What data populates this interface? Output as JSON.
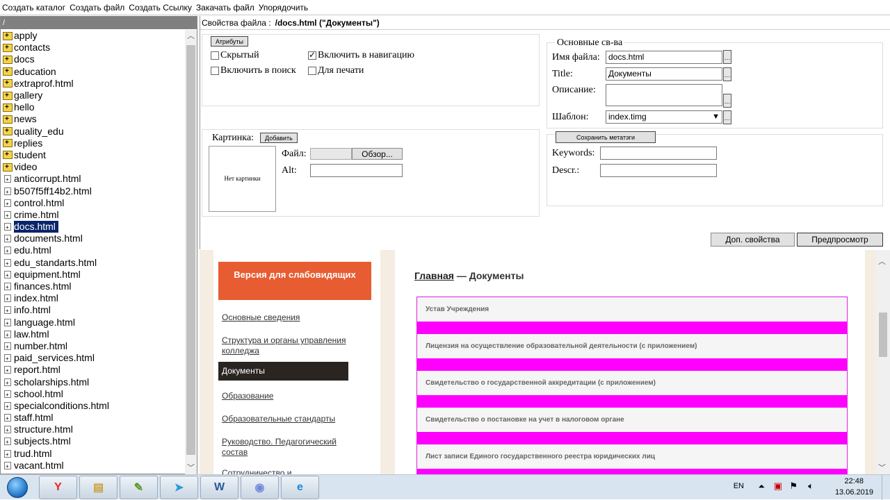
{
  "menu": [
    "Создать каталог",
    "Создать файл",
    "Создать Ссылку",
    "Закачать файл",
    "Упорядочить"
  ],
  "tree": {
    "root": "/",
    "folders": [
      "apply",
      "contacts",
      "docs",
      "education",
      "extraprof.html",
      "gallery",
      "hello",
      "news",
      "quality_edu",
      "replies",
      "student",
      "video"
    ],
    "files": [
      "anticorrupt.html",
      "b507f5ff14b2.html",
      "control.html",
      "crime.html",
      "docs.html",
      "documents.html",
      "edu.html",
      "edu_standarts.html",
      "equipment.html",
      "finances.html",
      "index.html",
      "info.html",
      "language.html",
      "law.html",
      "number.html",
      "paid_services.html",
      "report.html",
      "scholarships.html",
      "school.html",
      "specialconditions.html",
      "staff.html",
      "structure.html",
      "subjects.html",
      "trud.html",
      "vacant.html"
    ],
    "selected": "docs.html"
  },
  "props": {
    "title_label": "Свойства файла :",
    "title_value": "/docs.html (\"Документы\")",
    "attr_button": "Атрибуты",
    "cb_hidden": "Скрытый",
    "cb_nav": "Включить в навигацию",
    "cb_search": "Включить в поиск",
    "cb_print": "Для печати",
    "image_label": "Картинка:",
    "image_add": "Добавить",
    "no_image": "Нет картинки",
    "file_label": "Файл:",
    "browse": "Обзор...",
    "alt_label": "Alt:",
    "main_legend": "Основные св-ва",
    "filename_label": "Имя файла:",
    "filename_value": "docs.html",
    "title_field_label": "Title:",
    "title_field_value": "Документы",
    "desc_label": "Описание:",
    "template_label": "Шаблон:",
    "template_value": "index.timg",
    "save_meta": "Сохранить метатэги",
    "keywords_label": "Keywords:",
    "descr_label": "Descr.:",
    "extra_button": "Доп. свойства",
    "preview_button": "Предпросмотр"
  },
  "preview": {
    "vision_button": "Версия для слабовидящих",
    "nav": [
      "Основные сведения",
      "Структура и органы управления колледжа",
      "Документы",
      "Образование",
      "Образовательные стандарты",
      "Руководство. Педагогический состав",
      "Сотрудничество и ..."
    ],
    "active_nav": "Документы",
    "crumb_home": "Главная",
    "crumb_rest": " — Документы",
    "docs": [
      "Устав Учреждения",
      "Лицензия на осуществление образовательной деятельности (с приложением)",
      "Свидетельство о государственной аккредитации (с приложением)",
      "Свидетельство о постановке на учет в налоговом органе",
      "Лист записи Единого государственного реестра юридических лиц"
    ]
  },
  "taskbar": {
    "lang": "EN",
    "time": "22:48",
    "date": "13.06.2019",
    "apps": [
      "yandex-browser-icon",
      "file-explorer-icon",
      "notepad-plus-icon",
      "telegram-icon",
      "word-icon",
      "discord-icon",
      "internet-explorer-icon"
    ]
  },
  "colors": {
    "accent_orange": "#e85c32",
    "magenta": "#ff00ff",
    "selection": "#0a246a"
  }
}
